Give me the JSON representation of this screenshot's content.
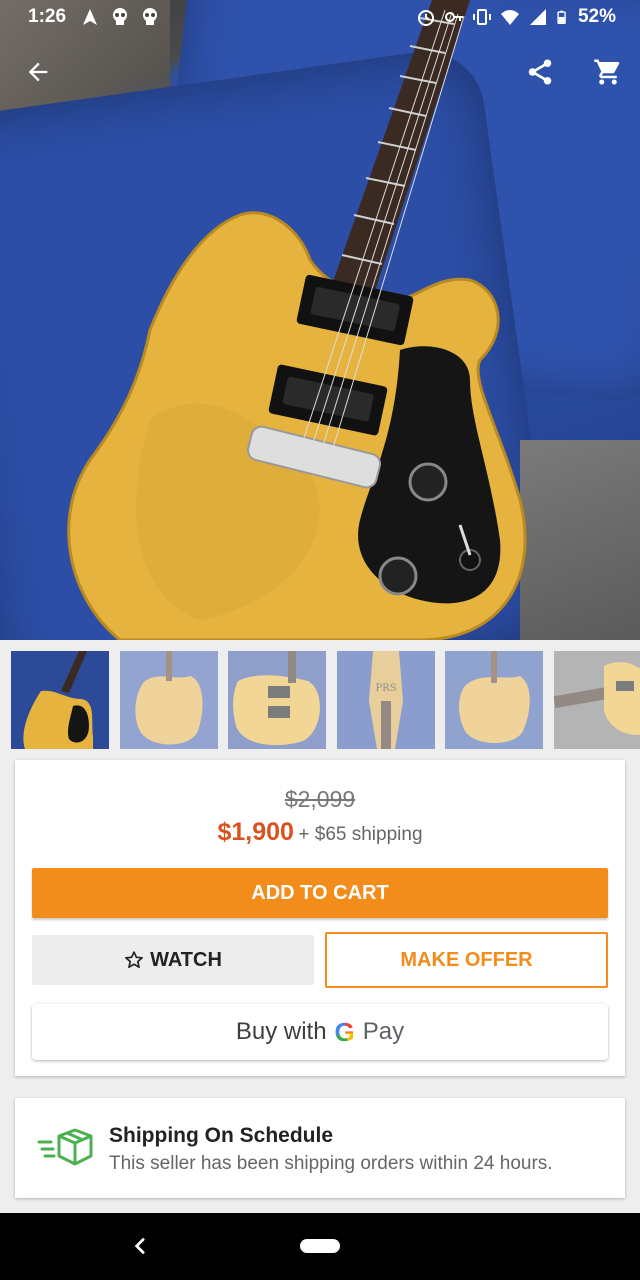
{
  "status_bar": {
    "time": "1:26",
    "battery": "52%",
    "left_icons": [
      "navigation-icon",
      "skull-icon",
      "skull-icon"
    ],
    "right_icons": [
      "alarm-icon",
      "vpn-key-icon",
      "vibrate-icon",
      "wifi-icon",
      "signal-icon",
      "battery-icon"
    ]
  },
  "app_bar": {
    "back_icon": "arrow-back-icon",
    "share_icon": "share-icon",
    "cart_icon": "cart-icon"
  },
  "gallery": {
    "thumbnail_count": 6,
    "selected_index": 0
  },
  "pricing": {
    "original_price": "$2,099",
    "price": "$1,900",
    "shipping": "+ $65 shipping"
  },
  "actions": {
    "add_to_cart": "ADD TO CART",
    "watch": "WATCH",
    "watch_icon": "star-outline-icon",
    "make_offer": "MAKE OFFER",
    "gpay_prefix": "Buy with",
    "gpay_g": "G",
    "gpay_pay": "Pay"
  },
  "shipping_badge": {
    "icon": "fast-shipping-box-icon",
    "title": "Shipping On Schedule",
    "description": "This seller has been shipping orders within 24 hours."
  },
  "colors": {
    "accent_orange": "#f28c1a",
    "price_orange": "#d9531e",
    "shipping_icon_green": "#4caf50"
  }
}
